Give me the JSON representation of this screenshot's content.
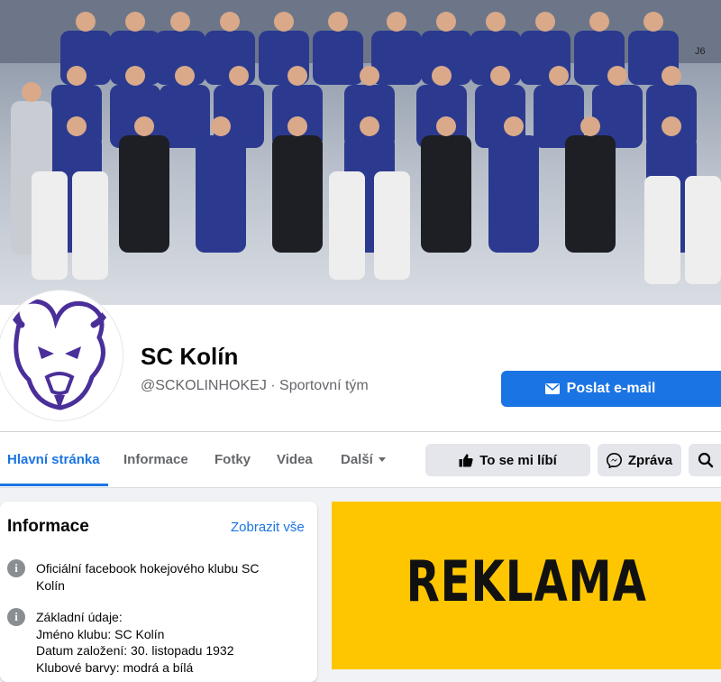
{
  "page": {
    "name": "SC Kolín",
    "handle_category": "@SCKOLINHOKEJ · Sportovní tým",
    "email_button": "Poslat e-mail",
    "colors": {
      "accent": "#1b74e4",
      "team_blue": "#2b3a8f",
      "ad_yellow": "#fec601"
    }
  },
  "cover": {
    "rink_marker": "J6"
  },
  "tabs": [
    {
      "label": "Hlavní stránka",
      "active": true
    },
    {
      "label": "Informace"
    },
    {
      "label": "Fotky"
    },
    {
      "label": "Videa"
    },
    {
      "label": "Další"
    }
  ],
  "actions": {
    "like": "To se mi líbí",
    "message": "Zpráva",
    "icons": [
      "thumbs-up-icon",
      "messenger-icon",
      "search-icon",
      "envelope-icon"
    ]
  },
  "info_card": {
    "title": "Informace",
    "see_all": "Zobrazit vše",
    "rows": [
      {
        "lines": [
          "Oficiální facebook hokejového klubu SC Kolín"
        ]
      },
      {
        "lines": [
          "Základní údaje:",
          "Jméno klubu: SC Kolín",
          "Datum založení: 30. listopadu 1932",
          "Klubové barvy: modrá a bílá"
        ]
      }
    ]
  },
  "ad": {
    "text": "REKLAMA"
  }
}
